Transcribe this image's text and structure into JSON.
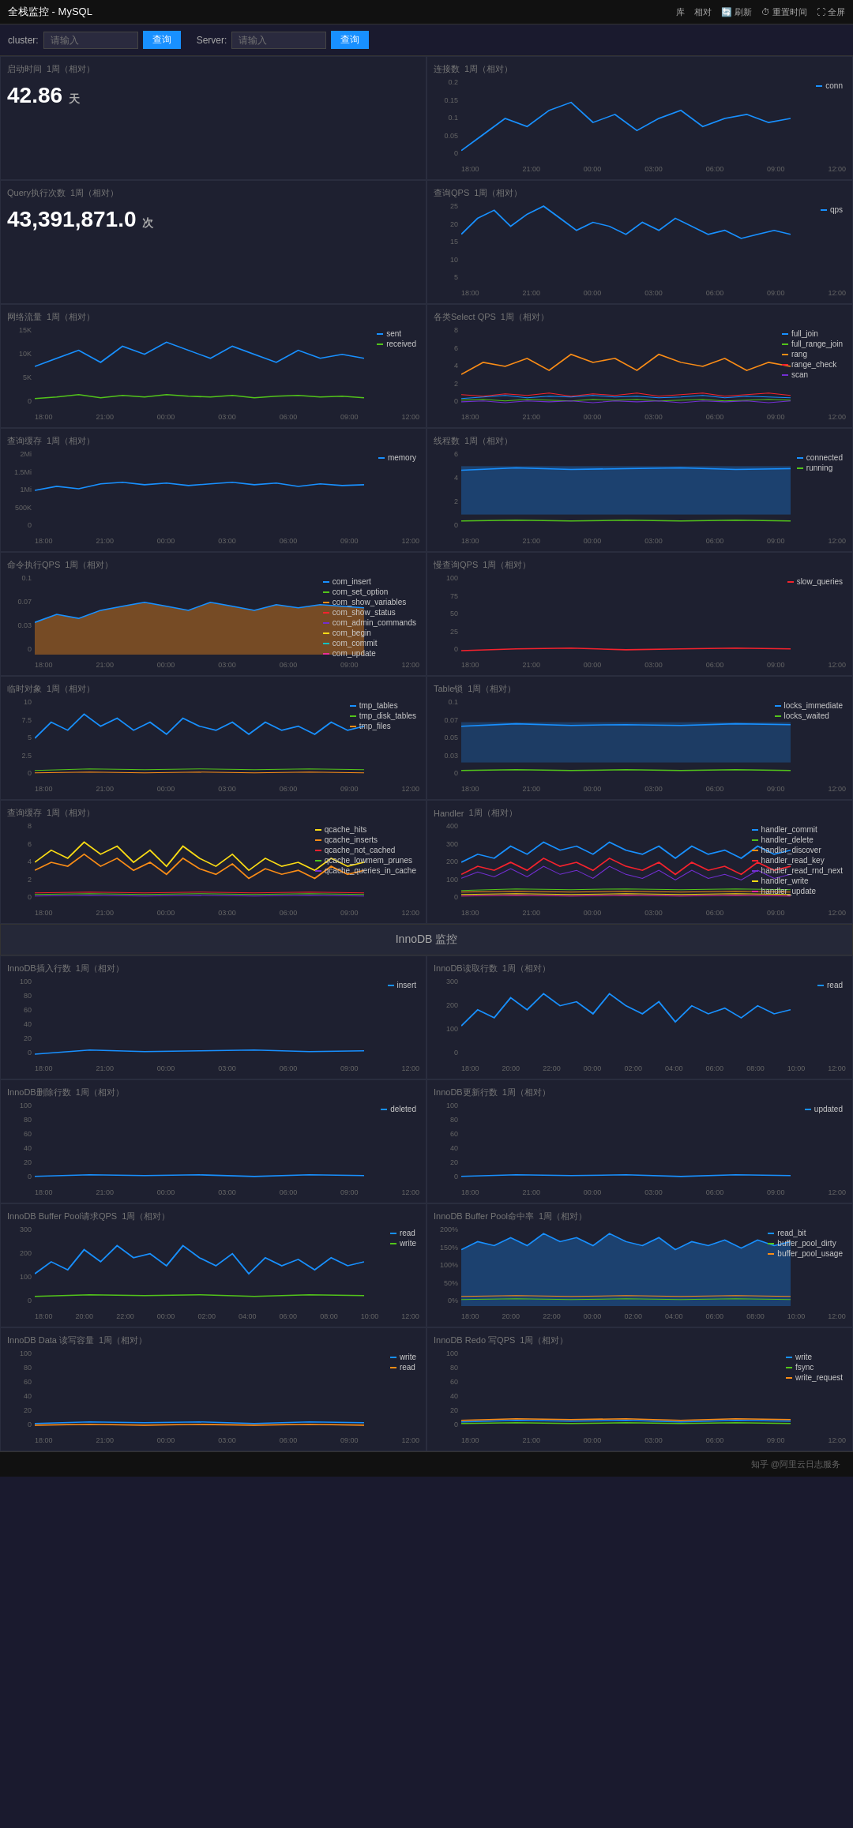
{
  "app": {
    "title": "全栈监控 - MySQL"
  },
  "topbar": {
    "title": "全栈监控 - MySQL",
    "buttons": [
      "库",
      "相对",
      "刷新",
      "重置时间",
      "全屏"
    ]
  },
  "filterbar": {
    "cluster_label": "cluster:",
    "cluster_placeholder": "请输入",
    "cluster_btn": "查询",
    "server_label": "Server:",
    "server_placeholder": "请输入",
    "server_btn": "查询"
  },
  "panels": {
    "startup_time": {
      "title": "启动时间",
      "period": "1周（相对）",
      "value": "42.86",
      "unit": "天"
    },
    "connections": {
      "title": "连接数",
      "period": "1周（相对）",
      "legend": [
        {
          "label": "conn",
          "color": "#1890ff"
        }
      ]
    },
    "query_qps": {
      "title": "查询QPS",
      "period": "1周（相对）",
      "legend": [
        {
          "label": "qps",
          "color": "#1890ff"
        }
      ]
    },
    "query_count": {
      "title": "Query执行次数",
      "period": "1周（相对）",
      "value": "43,391,871.0",
      "unit": "次"
    },
    "network": {
      "title": "网络流量",
      "period": "1周（相对）",
      "legend": [
        {
          "label": "sent",
          "color": "#1890ff"
        },
        {
          "label": "received",
          "color": "#52c41a"
        }
      ]
    },
    "select_qps": {
      "title": "各类Select QPS",
      "period": "1周（相对）",
      "legend": [
        {
          "label": "full_join",
          "color": "#1890ff"
        },
        {
          "label": "full_range_join",
          "color": "#52c41a"
        },
        {
          "label": "rang",
          "color": "#fa8c16"
        },
        {
          "label": "range_check",
          "color": "#f5222d"
        },
        {
          "label": "scan",
          "color": "#722ed1"
        }
      ]
    },
    "query_cache": {
      "title": "查询缓存",
      "period": "1周（相对）",
      "legend": [
        {
          "label": "memory",
          "color": "#1890ff"
        }
      ]
    },
    "threads": {
      "title": "线程数",
      "period": "1周（相对）",
      "legend": [
        {
          "label": "connected",
          "color": "#1890ff"
        },
        {
          "label": "running",
          "color": "#52c41a"
        }
      ]
    },
    "cmd_qps": {
      "title": "命令执行QPS",
      "period": "1周（相对）",
      "legend": [
        {
          "label": "com_insert",
          "color": "#1890ff"
        },
        {
          "label": "com_set_option",
          "color": "#52c41a"
        },
        {
          "label": "com_show_variables",
          "color": "#fa8c16"
        },
        {
          "label": "com_show_status",
          "color": "#f5222d"
        },
        {
          "label": "com_admin_commands",
          "color": "#722ed1"
        },
        {
          "label": "com_begin",
          "color": "#fadb14"
        },
        {
          "label": "com_commit",
          "color": "#13c2c2"
        },
        {
          "label": "com_update",
          "color": "#eb2f96"
        }
      ]
    },
    "slow_query": {
      "title": "慢查询QPS",
      "period": "1周（相对）",
      "legend": [
        {
          "label": "slow_queries",
          "color": "#f5222d"
        }
      ]
    },
    "tmp_objects": {
      "title": "临时对象",
      "period": "1周（相对）",
      "legend": [
        {
          "label": "tmp_tables",
          "color": "#1890ff"
        },
        {
          "label": "tmp_disk_tables",
          "color": "#52c41a"
        },
        {
          "label": "tmp_files",
          "color": "#fa8c16"
        }
      ]
    },
    "table_locks": {
      "title": "Table锁",
      "period": "1周（相对）",
      "legend": [
        {
          "label": "locks_immediate",
          "color": "#1890ff"
        },
        {
          "label": "locks_waited",
          "color": "#52c41a"
        }
      ]
    },
    "qcache": {
      "title": "查询缓存",
      "period": "1周（相对）",
      "legend": [
        {
          "label": "qcache_hits",
          "color": "#fadb14"
        },
        {
          "label": "qcache_inserts",
          "color": "#fa8c16"
        },
        {
          "label": "qcache_not_cached",
          "color": "#f5222d"
        },
        {
          "label": "qcache_lowmem_prunes",
          "color": "#52c41a"
        },
        {
          "label": "qcache_queries_in_cache",
          "color": "#722ed1"
        }
      ]
    },
    "handler": {
      "title": "Handler",
      "period": "1周（相对）",
      "legend": [
        {
          "label": "handler_commit",
          "color": "#1890ff"
        },
        {
          "label": "handler_delete",
          "color": "#52c41a"
        },
        {
          "label": "handler_discover",
          "color": "#fa8c16"
        },
        {
          "label": "handler_read_key",
          "color": "#f5222d"
        },
        {
          "label": "handler_read_rnd_next",
          "color": "#722ed1"
        },
        {
          "label": "handler_write",
          "color": "#fadb14"
        },
        {
          "label": "handler_update",
          "color": "#eb2f96"
        }
      ]
    },
    "innodb_section": "InnoDB 监控",
    "innodb_insert": {
      "title": "InnoDB插入行数",
      "period": "1周（相对）",
      "legend": [
        {
          "label": "insert",
          "color": "#1890ff"
        }
      ]
    },
    "innodb_read": {
      "title": "InnoDB读取行数",
      "period": "1周（相对）",
      "legend": [
        {
          "label": "read",
          "color": "#1890ff"
        }
      ]
    },
    "innodb_delete": {
      "title": "InnoDB删除行数",
      "period": "1周（相对）",
      "legend": [
        {
          "label": "deleted",
          "color": "#1890ff"
        }
      ]
    },
    "innodb_update": {
      "title": "InnoDB更新行数",
      "period": "1周（相对）",
      "legend": [
        {
          "label": "updated",
          "color": "#1890ff"
        }
      ]
    },
    "innodb_bp_req": {
      "title": "InnoDB Buffer Pool请求QPS",
      "period": "1周（相对）",
      "legend": [
        {
          "label": "read",
          "color": "#1890ff"
        },
        {
          "label": "write",
          "color": "#52c41a"
        }
      ]
    },
    "innodb_bp_hit": {
      "title": "InnoDB Buffer Pool命中率",
      "period": "1周（相对）",
      "legend": [
        {
          "label": "read_bit",
          "color": "#1890ff"
        },
        {
          "label": "buffer_pool_dirty",
          "color": "#52c41a"
        },
        {
          "label": "buffer_pool_usage",
          "color": "#fa8c16"
        }
      ]
    },
    "innodb_data_io": {
      "title": "InnoDB Data 读写容量",
      "period": "1周（相对）",
      "legend": [
        {
          "label": "write",
          "color": "#1890ff"
        },
        {
          "label": "read",
          "color": "#fa8c16"
        }
      ]
    },
    "innodb_redo": {
      "title": "InnoDB Redo 写QPS",
      "period": "1周（相对）",
      "legend": [
        {
          "label": "write",
          "color": "#1890ff"
        },
        {
          "label": "fsync",
          "color": "#52c41a"
        },
        {
          "label": "write_request",
          "color": "#fa8c16"
        }
      ]
    }
  },
  "xaxis_labels": [
    "18:00",
    "21:00",
    "00:00",
    "03:00",
    "06:00",
    "09:00",
    "12:00"
  ],
  "footer": "知乎 @阿里云日志服务"
}
